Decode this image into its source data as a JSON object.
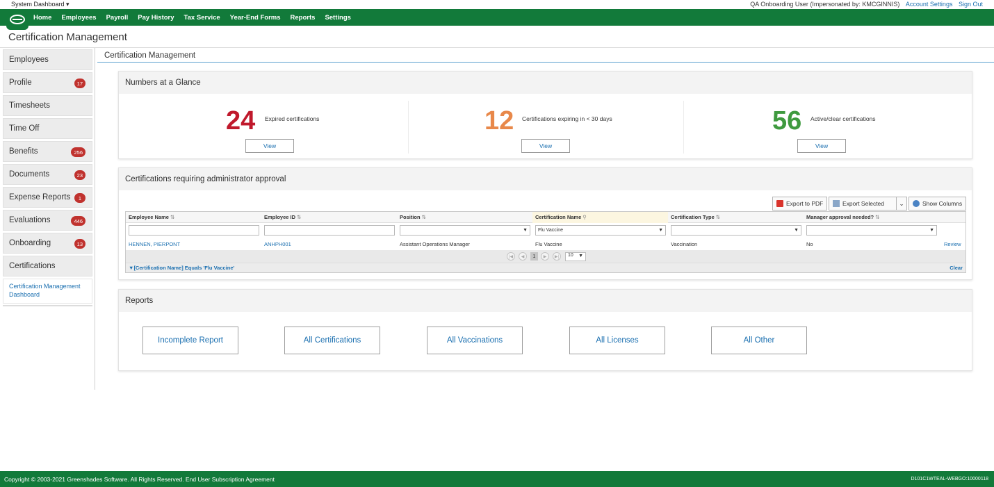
{
  "topbar": {
    "system_dashboard": "System Dashboard ▾",
    "user_text": "QA Onboarding User (Impersonated by: KMCGINNIS)",
    "account_settings": "Account Settings",
    "sign_out": "Sign Out"
  },
  "nav": [
    "Home",
    "Employees",
    "Payroll",
    "Pay History",
    "Tax Service",
    "Year-End Forms",
    "Reports",
    "Settings"
  ],
  "page_title": "Certification Management",
  "breadcrumb": "Certification Management",
  "sidebar": {
    "items": [
      {
        "label": "Employees",
        "badge": ""
      },
      {
        "label": "Profile",
        "badge": "17"
      },
      {
        "label": "Timesheets",
        "badge": ""
      },
      {
        "label": "Time Off",
        "badge": ""
      },
      {
        "label": "Benefits",
        "badge": "256"
      },
      {
        "label": "Documents",
        "badge": "23"
      },
      {
        "label": "Expense Reports",
        "badge": "1"
      },
      {
        "label": "Evaluations",
        "badge": "446"
      },
      {
        "label": "Onboarding",
        "badge": "13"
      },
      {
        "label": "Certifications",
        "badge": ""
      }
    ],
    "sub_item": "Certification Management Dashboard"
  },
  "glance": {
    "title": "Numbers at a Glance",
    "stats": [
      {
        "value": "24",
        "label": "Expired certifications",
        "button": "View",
        "color": "#c0192c"
      },
      {
        "value": "12",
        "label": "Certifications expiring in < 30 days",
        "button": "View",
        "color": "#e8884a"
      },
      {
        "value": "56",
        "label": "Active/clear certifications",
        "button": "View",
        "color": "#3f9a3f"
      }
    ]
  },
  "approval": {
    "title": "Certifications requiring administrator approval",
    "toolbar": {
      "export_pdf": "Export to PDF",
      "export_selected": "Export Selected",
      "show_columns": "Show Columns"
    },
    "columns": [
      "Employee Name",
      "Employee ID",
      "Position",
      "Certification Name",
      "Certification Type",
      "Manager approval needed?"
    ],
    "filters": [
      "",
      "",
      "",
      "Flu Vaccine",
      "",
      ""
    ],
    "rows": [
      {
        "name": "HENNEN, PIERPONT",
        "id": "ANHPH001",
        "position": "Assistant Operations Manager",
        "cert_name": "Flu Vaccine",
        "cert_type": "Vaccination",
        "manager": "No",
        "action": "Review"
      }
    ],
    "pager": {
      "page": "1",
      "page_size": "10"
    },
    "filter_text": "[Certification Name] Equals 'Flu Vaccine'",
    "clear": "Clear"
  },
  "reports": {
    "title": "Reports",
    "buttons": [
      "Incomplete Report",
      "All Certifications",
      "All Vaccinations",
      "All Licenses",
      "All Other"
    ]
  },
  "footer": {
    "copyright": "Copyright © 2003-2021 Greenshades Software. All Rights Reserved. End User Subscription Agreement",
    "build": "D101C1WTEAL-WEBGO:10000118"
  }
}
